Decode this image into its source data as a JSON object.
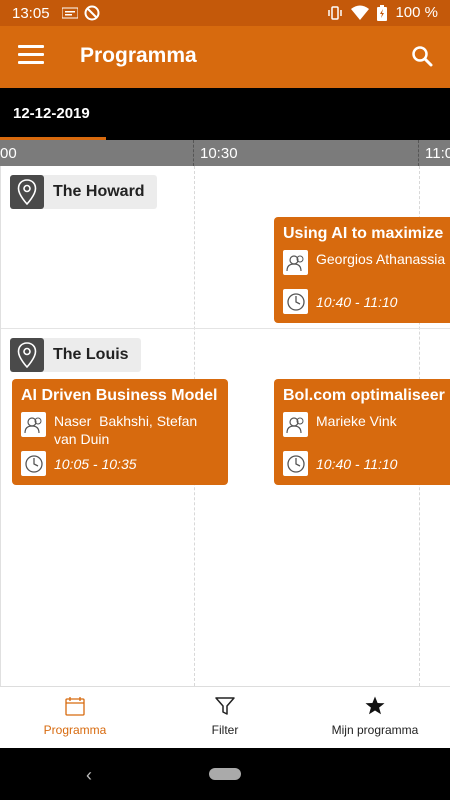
{
  "status_bar": {
    "time": "13:05",
    "battery": "100 %"
  },
  "app_bar": {
    "title": "Programma"
  },
  "date_tabs": [
    {
      "label": "12-12-2019",
      "active": true
    }
  ],
  "ruler": {
    "ticks": [
      "00",
      "10:30",
      "11:0"
    ]
  },
  "rooms": [
    {
      "name": "The Howard",
      "sessions": [
        {
          "title": "Using AI to maximize",
          "speakers": "Georgios Athanassia",
          "time": "10:40 - 11:10"
        }
      ]
    },
    {
      "name": "The Louis",
      "sessions": [
        {
          "title": "AI Driven Business Model",
          "speakers": "Naser  Bakhshi, Stefan van Duin",
          "time": "10:05 - 10:35"
        },
        {
          "title": "Bol.com optimaliseer",
          "speakers": "Marieke Vink",
          "time": "10:40 - 11:10"
        }
      ]
    }
  ],
  "bottom_nav": [
    {
      "label": "Programma",
      "icon": "calendar-icon",
      "active": true
    },
    {
      "label": "Filter",
      "icon": "filter-icon",
      "active": false
    },
    {
      "label": "Mijn programma",
      "icon": "star-icon",
      "active": false
    }
  ],
  "colors": {
    "accent": "#d76a0e",
    "status_bar": "#c4590a",
    "date_bar": "#000000",
    "ruler": "#7b7b7b"
  }
}
